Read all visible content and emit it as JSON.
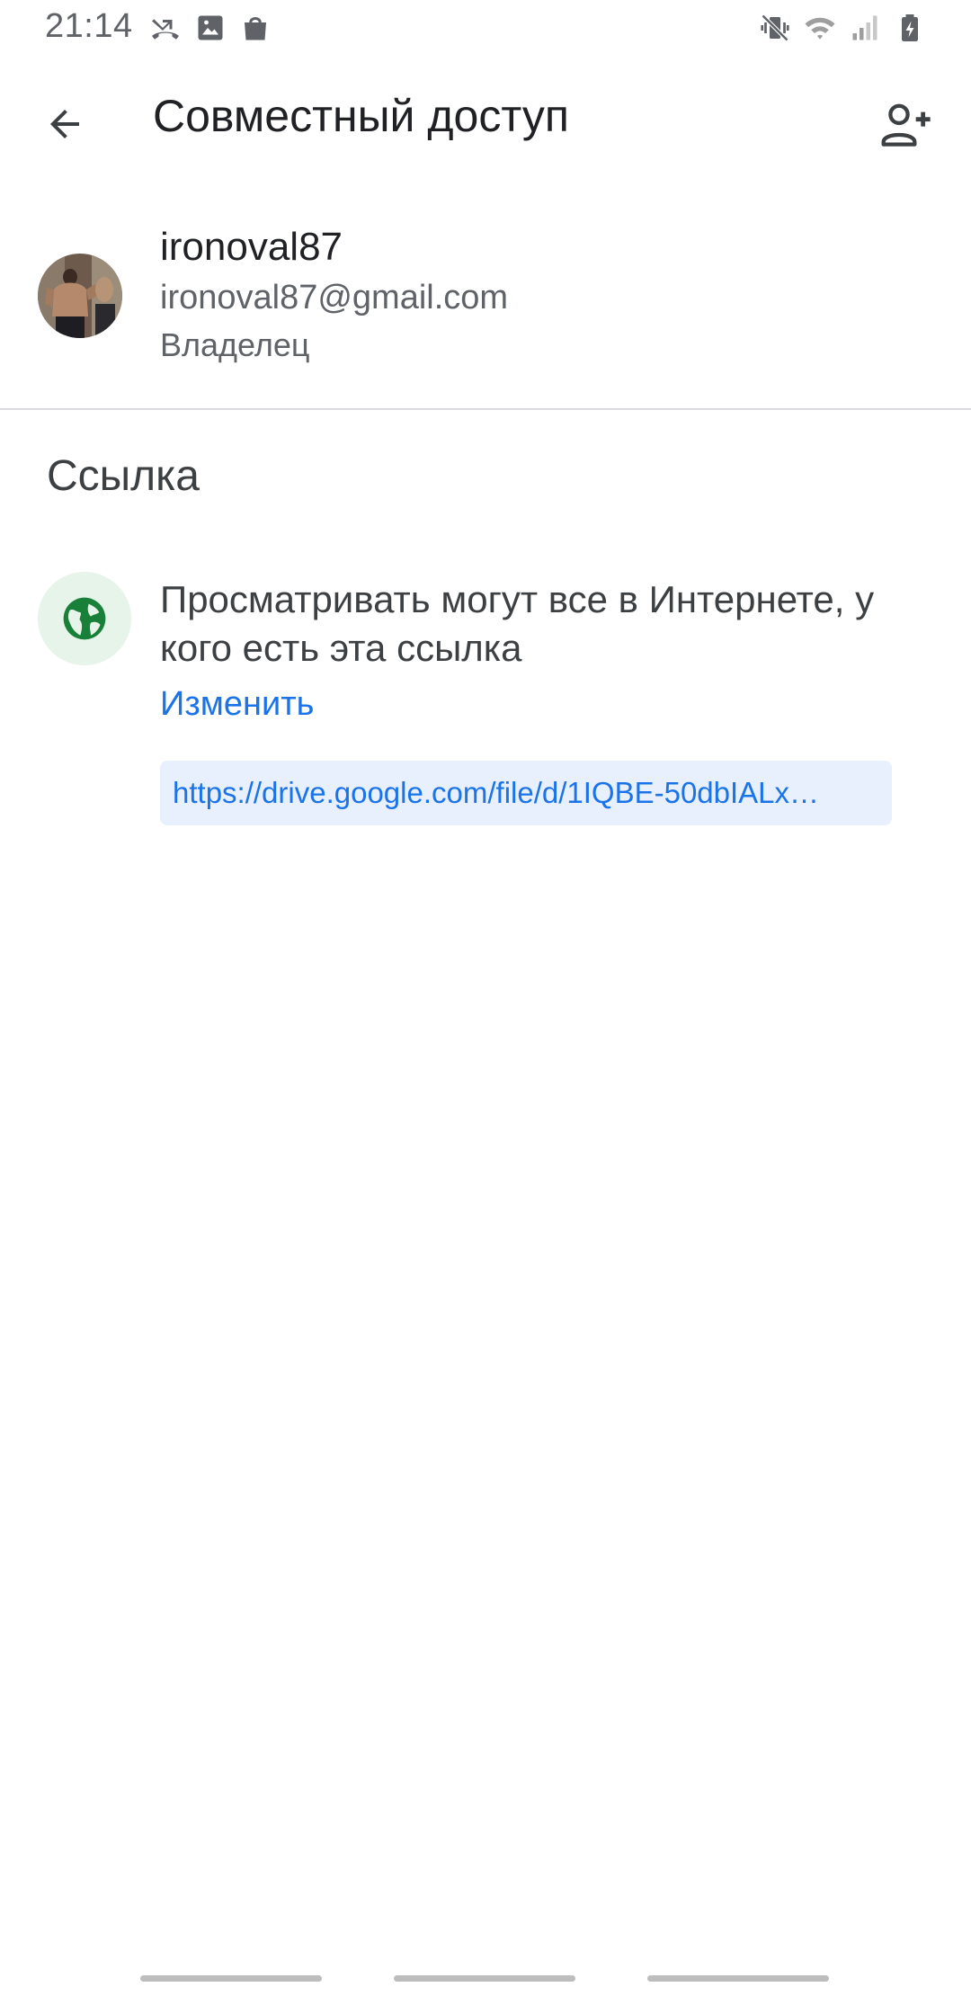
{
  "status_bar": {
    "time": "21:14",
    "left_icons": [
      "missed-call-icon",
      "image-icon",
      "shopping-bag-icon"
    ],
    "right_icons": [
      "vibrate-icon",
      "wifi-icon",
      "signal-icon",
      "battery-charging-icon"
    ]
  },
  "app_bar": {
    "title": "Совместный доступ",
    "back_icon": "arrow-back-icon",
    "add_icon": "person-add-icon"
  },
  "owner": {
    "name": "ironoval87",
    "email": "ironoval87@gmail.com",
    "role": "Владелец"
  },
  "link_section": {
    "title": "Ссылка",
    "access_text": "Просматривать могут все в Интернете, у кого есть эта ссылка",
    "change_label": "Изменить",
    "url": "https://drive.google.com/file/d/1IQBE-50dbIALx…",
    "icon": "globe-icon"
  },
  "colors": {
    "accent": "#1a73e8",
    "globe_green": "#188038",
    "globe_bg": "#e6f4ea",
    "link_bg": "#e8f0fe"
  }
}
